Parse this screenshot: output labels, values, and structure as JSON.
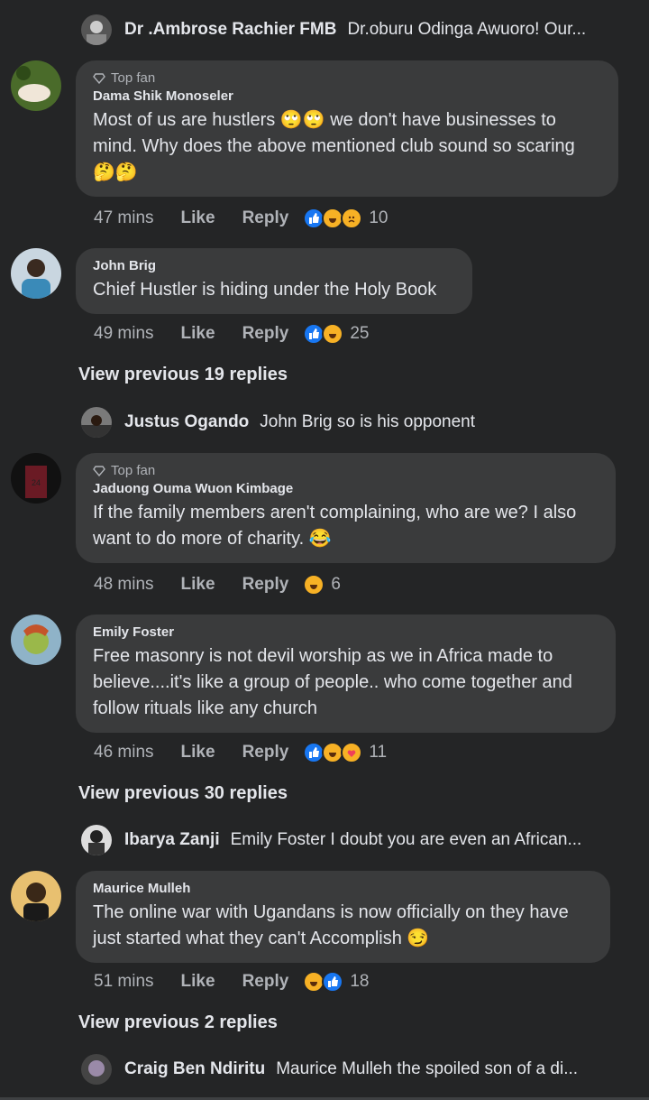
{
  "replies_top": [
    {
      "name": "Dr .Ambrose Rachier FMB",
      "text": "Dr.oburu Odinga Awuoro! Our..."
    }
  ],
  "comments": [
    {
      "badge": "Top fan",
      "author": "Dama Shik Monoseler",
      "body_lines": [
        "Most of us are hustlers 🙄🙄 we don't have businesses to",
        "mind. Why does the above mentioned club sound so scaring",
        "🤔🤔"
      ],
      "time": "47 mins",
      "like": "Like",
      "reply": "Reply",
      "reactions": [
        "like",
        "haha",
        "sad"
      ],
      "count": "10"
    },
    {
      "author": "John Brig",
      "body_lines": [
        "Chief Hustler is hiding under the Holy Book"
      ],
      "time": "49 mins",
      "like": "Like",
      "reply": "Reply",
      "reactions": [
        "like",
        "haha"
      ],
      "count": "25"
    },
    {
      "badge": "Top fan",
      "author": "Jaduong Ouma Wuon Kimbage",
      "body_lines": [
        "If the family members aren't complaining, who are we? I also",
        "want to do more of charity. 😂"
      ],
      "time": "48 mins",
      "like": "Like",
      "reply": "Reply",
      "reactions": [
        "haha"
      ],
      "count": "6"
    },
    {
      "author": "Emily Foster",
      "body_lines": [
        "Free masonry is not devil worship as we in  Africa made to",
        "believe....it's like a group of people.. who come together and",
        "follow rituals like any church"
      ],
      "time": "46 mins",
      "like": "Like",
      "reply": "Reply",
      "reactions": [
        "like",
        "haha",
        "care"
      ],
      "count": "11"
    },
    {
      "author": "Maurice Mulleh",
      "body_lines": [
        "The online war with Ugandans is now officially on they have",
        "just started what they can't Accomplish 😏"
      ],
      "time": "51 mins",
      "like": "Like",
      "reply": "Reply",
      "reactions": [
        "haha",
        "like"
      ],
      "count": "18"
    }
  ],
  "view_previous": [
    "View previous 19 replies",
    "View previous 30 replies",
    "View previous 2 replies"
  ],
  "replies": [
    {
      "name": "Justus Ogando",
      "text": "John Brig so is his opponent"
    },
    {
      "name": "Ibarya Zanji",
      "text": "Emily Foster I doubt you are even an African..."
    },
    {
      "name": "Craig Ben Ndiritu",
      "text": "Maurice Mulleh the spoiled son of a di..."
    }
  ],
  "colors": {
    "background": "#242526",
    "bubble": "#3a3b3c",
    "text": "#e4e6eb",
    "secondary_text": "#b0b3b8",
    "like_blue": "#1877f2",
    "haha_yellow": "#f7b125"
  }
}
